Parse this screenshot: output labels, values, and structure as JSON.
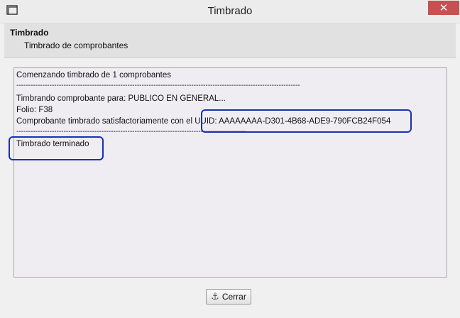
{
  "window": {
    "title": "Timbrado",
    "close_glyph": "✕",
    "app_icon": "window-app-icon"
  },
  "header": {
    "title": "Timbrado",
    "subtitle": "Timbrado de comprobantes"
  },
  "log": {
    "lines": [
      "Comenzando timbrado de 1 comprobantes",
      "------------------------------------------------------------------------------------------------------------------------",
      "Timbrando comprobante para: PUBLICO EN GENERAL...",
      "Folio: F38",
      "Comprobante timbrado satisfactoriamente con el UUID: AAAAAAAA-D301-4B68-ADE9-790FCB24F054",
      "-------------------------------------------------------------------------------------------------",
      "Timbrado terminado"
    ],
    "highlight_color": "#1c2fb8"
  },
  "footer": {
    "close_button_label": "Cerrar",
    "close_button_icon": "anchor-icon"
  }
}
